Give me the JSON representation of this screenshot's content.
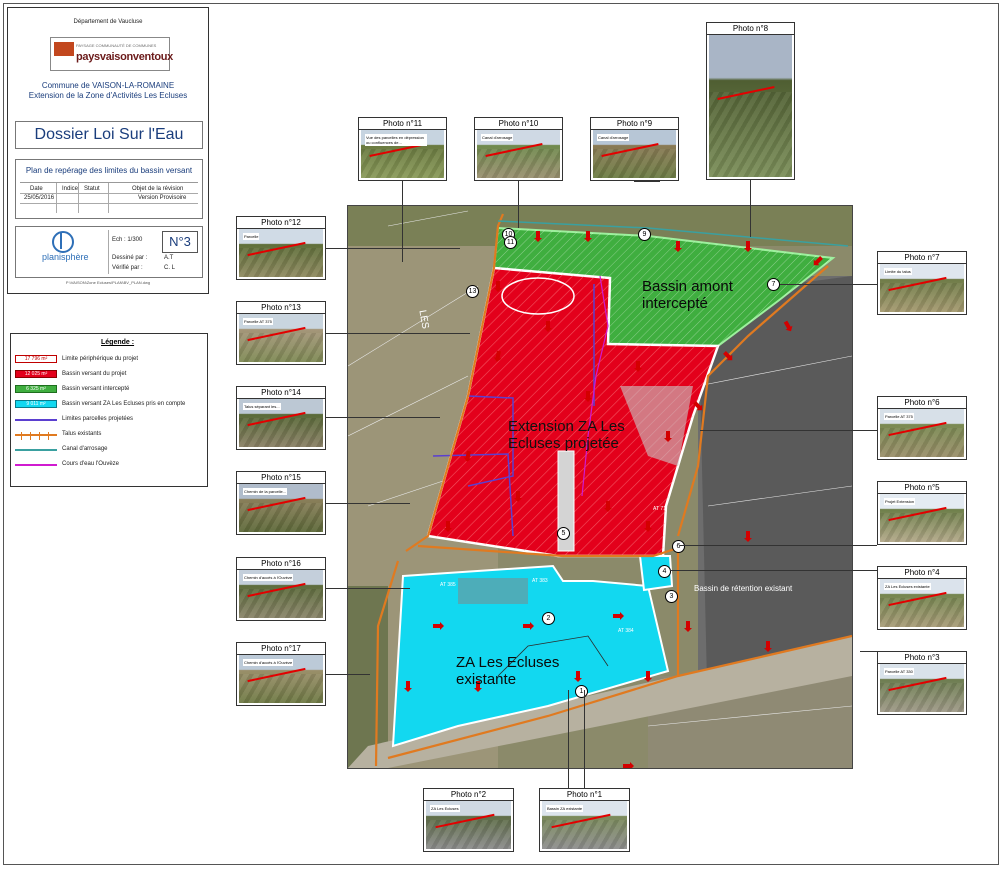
{
  "title_block": {
    "department": "Département de Vaucluse",
    "logo_top": "PAYSAGE COMMUNAUTÉ DE COMMUNES",
    "logo_main": "paysvaisonventoux",
    "commune": "Commune de VAISON-LA-ROMAINE",
    "project": "Extension de la Zone d'Activités Les Ecluses",
    "dossier": "Dossier Loi Sur l'Eau",
    "plan_title": "Plan de repérage des limites du bassin versant",
    "table_headers": [
      "Date",
      "Indice",
      "Statut",
      "Objet de la révision"
    ],
    "table_row": [
      "25/05/2016",
      "",
      "",
      "Version Provisoire"
    ],
    "scale": "Ech : 1/300",
    "plan_number": "N°3",
    "designed_label": "Dessiné par :",
    "designed_value": "A.T",
    "checked_label": "Vérifié par :",
    "checked_value": "C. L",
    "firm": "planisphère",
    "footer": "P:\\VAISON\\Zone Ecluses\\PLAN\\BV_PLAN.dwg"
  },
  "legend": {
    "title": "Légende :",
    "items": [
      {
        "swatch": "17 796 m²",
        "label": "Limite périphérique du projet",
        "type": "box",
        "fill": "#ffffff",
        "stroke": "#c00000"
      },
      {
        "swatch": "12 025 m²",
        "label": "Bassin versant du projet",
        "type": "box",
        "fill": "#e3001b",
        "stroke": "#8a0000"
      },
      {
        "swatch": "6 325 m²",
        "label": "Bassin versant intercepté",
        "type": "box",
        "fill": "#3fae3f",
        "stroke": "#1e6e1e"
      },
      {
        "swatch": "9 011 m²",
        "label": "Bassin versant ZA Les Ecluses pris en compte",
        "type": "box",
        "fill": "#12d8f0",
        "stroke": "#0a7b8a"
      },
      {
        "swatch": "",
        "label": "Limites parcelles projetées",
        "type": "line",
        "stroke": "#5b3fd0"
      },
      {
        "swatch": "",
        "label": "Talus existants",
        "type": "talus",
        "stroke": "#e07a20"
      },
      {
        "swatch": "",
        "label": "Canal d'arrosage",
        "type": "line",
        "stroke": "#3aa0a0"
      },
      {
        "swatch": "",
        "label": "Cours d'eau l'Ouvèze",
        "type": "line",
        "stroke": "#d01bd0"
      }
    ]
  },
  "photos": [
    {
      "id": "p8",
      "caption": "Photo n°8",
      "tone": [
        "#7c8f5a",
        "#4f5e32",
        "#a9b5c6"
      ]
    },
    {
      "id": "p11",
      "caption": "Photo n°11",
      "tone": [
        "#8a9a5a",
        "#6a7a40",
        "#c7d4e0"
      ],
      "note": "Vue des parcelles en dépression ou confluences de..."
    },
    {
      "id": "p10",
      "caption": "Photo n°10",
      "tone": [
        "#9a9070",
        "#6f8a4d",
        "#cfd9e4"
      ],
      "note": "Canal d'arrosage"
    },
    {
      "id": "p9",
      "caption": "Photo n°9",
      "tone": [
        "#6d7d45",
        "#8a7a55",
        "#b7c6d6"
      ],
      "note": "Canal d'arrosage"
    },
    {
      "id": "p12",
      "caption": "Photo n°12",
      "tone": [
        "#8f8a60",
        "#5f6f3a",
        "#d0dbe6"
      ],
      "note": "Parcelle"
    },
    {
      "id": "p7",
      "caption": "Photo n°7",
      "tone": [
        "#a59a70",
        "#6f7c48",
        "#dfe6ee"
      ],
      "note": "Limite du talus"
    },
    {
      "id": "p13",
      "caption": "Photo n°13",
      "tone": [
        "#7f8a55",
        "#a5967a",
        "#c9d5df"
      ],
      "note": "Parcelle AT 375"
    },
    {
      "id": "p14",
      "caption": "Photo n°14",
      "tone": [
        "#8a8066",
        "#596a38",
        "#bcc8d4"
      ],
      "note": "Talus séparant les..."
    },
    {
      "id": "p6",
      "caption": "Photo n°6",
      "tone": [
        "#9a8f6a",
        "#7a8a52",
        "#d7e0e8"
      ],
      "note": "Parcelle AT 375"
    },
    {
      "id": "p15",
      "caption": "Photo n°15",
      "tone": [
        "#5e6a3a",
        "#8a7f5a",
        "#b0bccb"
      ],
      "note": "Chemin de la parcelle..."
    },
    {
      "id": "p5",
      "caption": "Photo n°5",
      "tone": [
        "#b3a98a",
        "#6e7f4a",
        "#e4ebf2"
      ],
      "note": "Projet Extension"
    },
    {
      "id": "p16",
      "caption": "Photo n°16",
      "tone": [
        "#8a856a",
        "#5d6c3c",
        "#c4cfdb"
      ],
      "note": "Chemin d'accès à l'Ouvèze"
    },
    {
      "id": "p4",
      "caption": "Photo n°4",
      "tone": [
        "#a89c78",
        "#74854f",
        "#dbe3ec"
      ],
      "note": "ZA Les Ecluses existante"
    },
    {
      "id": "p17",
      "caption": "Photo n°17",
      "tone": [
        "#6f7a45",
        "#9a8f6a",
        "#bccad8"
      ],
      "note": "Chemin d'accès à l'Ouvèze"
    },
    {
      "id": "p3",
      "caption": "Photo n°3",
      "tone": [
        "#9f9a88",
        "#6d7d50",
        "#d9e2ea"
      ],
      "note": "Parcelle AT 330"
    },
    {
      "id": "p2",
      "caption": "Photo n°2",
      "tone": [
        "#8c8c8c",
        "#5f6e48",
        "#cfd9e3"
      ],
      "note": "ZA Les Ecluses"
    },
    {
      "id": "p1",
      "caption": "Photo n°1",
      "tone": [
        "#8e8e8e",
        "#7a8a5a",
        "#dce4ec"
      ],
      "note": "Bassin ZA existante"
    }
  ],
  "map": {
    "zone_green": [
      "Bassin amont",
      "intercepté"
    ],
    "zone_red": [
      "Extension ZA Les",
      "Ecluses projetée"
    ],
    "zone_cyan": [
      "ZA Les Ecluses",
      "existante"
    ],
    "retention_label": "Bassin de rétention existant",
    "lieu_dit": "LES",
    "parcels": [
      "AT 385",
      "AT 383",
      "AT 384",
      "AT 71",
      "AT 385"
    ],
    "markers": [
      "1",
      "2",
      "3",
      "4",
      "5",
      "6",
      "7",
      "9",
      "10",
      "11",
      "13"
    ]
  }
}
